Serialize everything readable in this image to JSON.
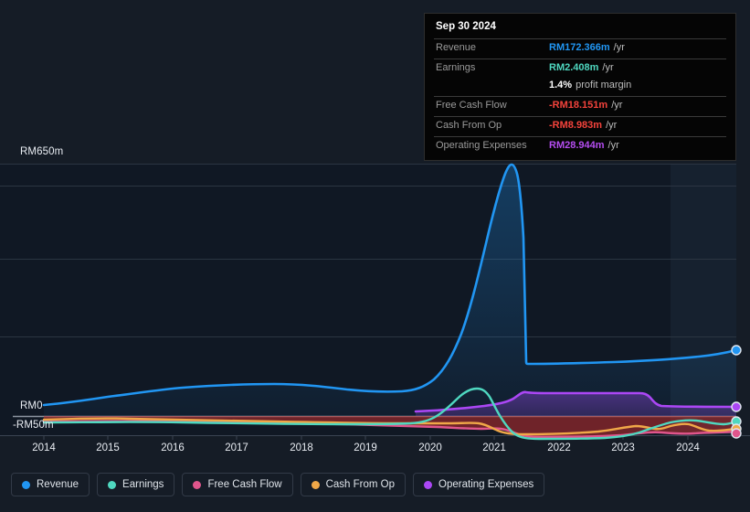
{
  "theme": {
    "background": "#151c26",
    "plot_background": "#0f1620",
    "forecast_band": "#16202e",
    "gridline": "#2a333f",
    "axis_text": "#e8ecf2"
  },
  "axes": {
    "y_top_label": "RM650m",
    "y_zero_label": "RM0",
    "y_negative_label": "-RM50m",
    "x_ticks": [
      "2014",
      "2015",
      "2016",
      "2017",
      "2018",
      "2019",
      "2020",
      "2021",
      "2022",
      "2023",
      "2024"
    ]
  },
  "tooltip": {
    "date": "Sep 30 2024",
    "rows": [
      {
        "label": "Revenue",
        "value": "RM172.366m",
        "unit": "/yr",
        "color": "#2196f3"
      },
      {
        "label": "Earnings",
        "value": "RM2.408m",
        "unit": "/yr",
        "color": "#4fd8c0"
      },
      {
        "label": "",
        "value": "1.4%",
        "unit": "profit margin",
        "color": "#ffffff"
      },
      {
        "label": "Free Cash Flow",
        "value": "-RM18.151m",
        "unit": "/yr",
        "color": "#f4433c"
      },
      {
        "label": "Cash From Op",
        "value": "-RM8.983m",
        "unit": "/yr",
        "color": "#f4433c"
      },
      {
        "label": "Operating Expenses",
        "value": "RM28.944m",
        "unit": "/yr",
        "color": "#b44df0"
      }
    ]
  },
  "legend": {
    "items": [
      {
        "label": "Revenue",
        "color": "#2196f3"
      },
      {
        "label": "Earnings",
        "color": "#4fd8c0"
      },
      {
        "label": "Free Cash Flow",
        "color": "#e0558c"
      },
      {
        "label": "Cash From Op",
        "color": "#f0a848"
      },
      {
        "label": "Operating Expenses",
        "color": "#ab47f5"
      }
    ]
  },
  "chart_data": {
    "type": "line",
    "title": "",
    "xlabel": "",
    "ylabel": "",
    "x_unit": "year",
    "ylim": [
      -50,
      650
    ],
    "xlim": [
      2013.7,
      2024.75
    ],
    "grid": true,
    "gridline_values": [
      650,
      600,
      450,
      290,
      0
    ],
    "legend_position": "bottom-left",
    "currency": "RM",
    "units": "millions",
    "forecast_band_start": "2023.75",
    "annotations": [
      {
        "text": "Sep 30 2024",
        "type": "tooltip-date"
      },
      {
        "text": "1.4% profit margin",
        "type": "tooltip-note"
      }
    ],
    "series": [
      {
        "name": "Revenue",
        "color": "#2196f3",
        "fill": "rgba(33,150,243,0.16)",
        "endpoint_value": 172.366,
        "x": [
          2014.0,
          2014.5,
          2015.0,
          2015.5,
          2016.0,
          2016.5,
          2017.0,
          2017.5,
          2018.0,
          2018.5,
          2019.0,
          2019.5,
          2020.0,
          2020.3,
          2020.6,
          2020.9,
          2021.1,
          2021.25,
          2021.4,
          2021.55,
          2021.6,
          2022.0,
          2022.5,
          2023.0,
          2023.5,
          2024.0,
          2024.5,
          2024.75
        ],
        "values": [
          27,
          30,
          36,
          42,
          48,
          52,
          58,
          62,
          60,
          55,
          53,
          58,
          78,
          130,
          260,
          470,
          610,
          645,
          640,
          560,
          118,
          120,
          124,
          126,
          132,
          146,
          164,
          172.366
        ]
      },
      {
        "name": "Earnings",
        "color": "#4fd8c0",
        "endpoint_value": 2.408,
        "x": [
          2014.0,
          2015.0,
          2016.0,
          2017.0,
          2018.0,
          2019.0,
          2019.6,
          2020.0,
          2020.4,
          2020.8,
          2021.0,
          2021.2,
          2021.4,
          2021.6,
          2021.9,
          2022.3,
          2022.8,
          2023.2,
          2023.5,
          2023.9,
          2024.2,
          2024.5,
          2024.75
        ],
        "values": [
          -6,
          -6,
          -5,
          -5,
          -6,
          -7,
          -5,
          2,
          14,
          30,
          36,
          35,
          24,
          2,
          -18,
          -28,
          -29,
          -25,
          -14,
          -8,
          -5,
          0,
          2.408
        ]
      },
      {
        "name": "Free Cash Flow",
        "color": "#e0558c",
        "endpoint_value": -18.151,
        "x": [
          2014.0,
          2015.0,
          2016.0,
          2017.0,
          2018.0,
          2019.0,
          2019.5,
          2020.0,
          2020.5,
          2021.0,
          2021.3,
          2021.6,
          2022.0,
          2022.5,
          2023.0,
          2023.4,
          2023.8,
          2024.1,
          2024.4,
          2024.75
        ],
        "values": [
          -8,
          -8,
          -7,
          -7,
          -8,
          -9,
          -9,
          -10,
          -10,
          -11,
          -19,
          -25,
          -28,
          -29,
          -28,
          -22,
          -24,
          -20,
          -22,
          -18.151
        ]
      },
      {
        "name": "Cash From Op",
        "color": "#f0a848",
        "endpoint_value": -8.983,
        "x": [
          2014.0,
          2015.0,
          2016.0,
          2017.0,
          2018.0,
          2019.0,
          2019.5,
          2020.0,
          2020.5,
          2021.0,
          2021.3,
          2021.6,
          2022.0,
          2022.5,
          2023.0,
          2023.4,
          2023.7,
          2024.0,
          2024.3,
          2024.55,
          2024.75
        ],
        "values": [
          -6,
          -6,
          -6,
          -6,
          -7,
          -8,
          -8,
          -8,
          -9,
          -10,
          -16,
          -22,
          -24,
          -22,
          -18,
          -12,
          -8,
          -13,
          -9,
          -13,
          -8.983
        ]
      },
      {
        "name": "Operating Expenses",
        "color": "#ab47f5",
        "fill": "rgba(140,70,220,0.30)",
        "endpoint_value": 28.944,
        "x": [
          2019.6,
          2020.0,
          2020.5,
          2021.0,
          2021.3,
          2021.5,
          2021.65,
          2022.0,
          2022.5,
          2023.0,
          2023.2,
          2023.4,
          2023.6,
          2024.0,
          2024.4,
          2024.75
        ],
        "values": [
          9,
          9,
          10,
          12,
          16,
          33,
          38,
          38,
          38,
          38,
          37,
          30,
          29,
          29,
          29,
          28.944
        ]
      }
    ]
  }
}
